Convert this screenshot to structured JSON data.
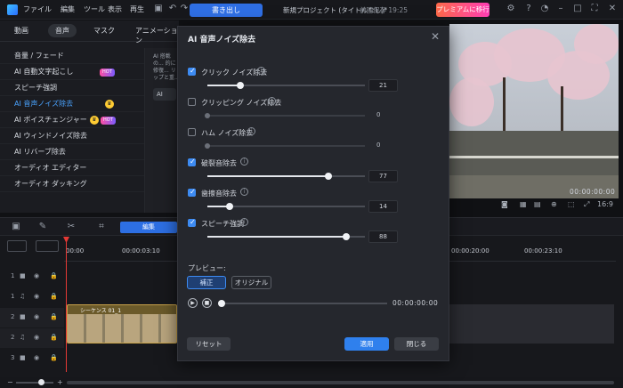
{
  "menubar": {
    "items": [
      "ファイル",
      "編集",
      "ツール",
      "表示",
      "再生"
    ],
    "export_label": "書き出し",
    "project_title": "新規プロジェクト (タイトルなし)*",
    "save_state": "前回保存 19:25",
    "premium_label": "プレミアムに移行"
  },
  "left": {
    "tabs": [
      "動画",
      "音声",
      "マスク",
      "アニメーション"
    ],
    "active_tab": "音声",
    "effects": [
      {
        "label": "音量 / フェード"
      },
      {
        "label": "AI 自動文字起こし",
        "hot": "HOT"
      },
      {
        "label": "スピーチ強調"
      },
      {
        "label": "AI 音声ノイズ除去",
        "crown": true
      },
      {
        "label": "AI ボイスチェンジャー",
        "crown": true,
        "hot": "HOT"
      },
      {
        "label": "AI ウィンドノイズ除去"
      },
      {
        "label": "AI リバーブ除去"
      },
      {
        "label": "オーディオ エディター"
      },
      {
        "label": "オーディオ ダッキング"
      }
    ],
    "side_text": "AI 搭載の... 的に修復... リップと重...",
    "side_button": "AI"
  },
  "player": {
    "time": "00:00:00:00",
    "ratio": "16:9"
  },
  "timeline": {
    "edit_tab": "編集",
    "ticks": [
      "00:00",
      "00:00:03:10",
      "00:00:20:00",
      "00:00:23:10"
    ],
    "clip_title": "シーケンス 01_1",
    "tracks": [
      "1",
      "1",
      "2",
      "2",
      "3"
    ]
  },
  "modal": {
    "title": "AI 音声ノイズ除去",
    "options": [
      {
        "label": "クリック ノイズ除去",
        "checked": true,
        "value": 21
      },
      {
        "label": "クリッピング ノイズ除去",
        "checked": false,
        "value": 0
      },
      {
        "label": "ハム ノイズ除去",
        "checked": false,
        "value": 0
      },
      {
        "label": "破裂音除去",
        "checked": true,
        "value": 77
      },
      {
        "label": "歯擦音除去",
        "checked": true,
        "value": 14
      },
      {
        "label": "スピーチ強調",
        "checked": true,
        "value": 88
      }
    ],
    "preview_label": "プレビュー:",
    "mode_corrected": "補正",
    "mode_original": "オリジナル",
    "time": "00:00:00:00",
    "reset": "リセット",
    "apply": "適用",
    "close": "閉じる"
  }
}
